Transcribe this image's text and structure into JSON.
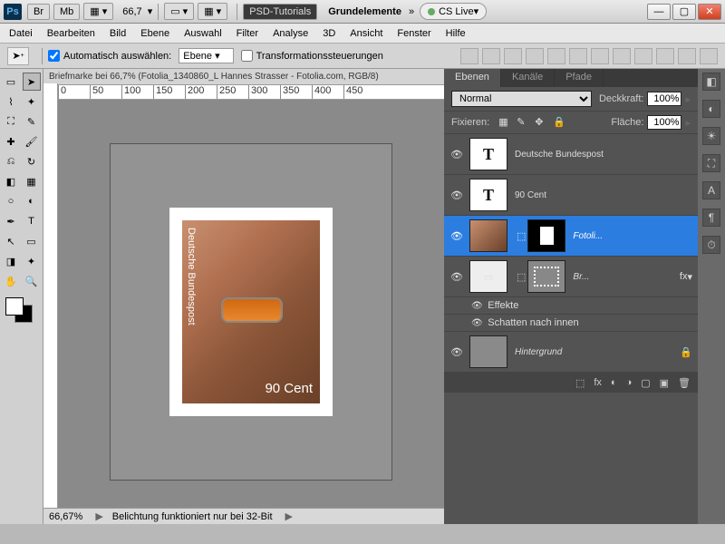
{
  "titlebar": {
    "bridge": "Br",
    "minibridge": "Mb",
    "zoom": "66,7",
    "tutorials": "PSD-Tutorials",
    "grundelemente": "Grundelemente",
    "chevrons": "»",
    "cslive": "CS Live"
  },
  "menu": [
    "Datei",
    "Bearbeiten",
    "Bild",
    "Ebene",
    "Auswahl",
    "Filter",
    "Analyse",
    "3D",
    "Ansicht",
    "Fenster",
    "Hilfe"
  ],
  "options": {
    "auto_select": "Automatisch auswählen:",
    "auto_select_val": "Ebene",
    "transform": "Transformationssteuerungen"
  },
  "doc_tab": "Briefmarke bei 66,7% (Fotolia_1340860_L Hannes Strasser - Fotolia.com, RGB/8)",
  "ruler_marks": [
    "0",
    "50",
    "100",
    "150",
    "200",
    "250",
    "300",
    "350",
    "400",
    "450"
  ],
  "stamp": {
    "top_text": "Deutsche Bundespost",
    "value": "90 Cent"
  },
  "status": {
    "zoom": "66,67%",
    "msg": "Belichtung funktioniert nur bei 32-Bit"
  },
  "panel": {
    "tabs": [
      "Ebenen",
      "Kanäle",
      "Pfade"
    ],
    "blend": "Normal",
    "opacity_label": "Deckkraft:",
    "opacity": "100%",
    "lock_label": "Fixieren:",
    "fill_label": "Fläche:",
    "fill": "100%",
    "layers": [
      {
        "name": "Deutsche Bundespost",
        "type": "text"
      },
      {
        "name": "90 Cent",
        "type": "text"
      },
      {
        "name": "Fotoli...",
        "type": "image",
        "selected": true
      },
      {
        "name": "Br...",
        "type": "stamp",
        "fx": true
      },
      {
        "name": "Hintergrund",
        "type": "bg",
        "locked": true
      }
    ],
    "effects_label": "Effekte",
    "effect_item": "Schatten nach innen",
    "fx_label": "fx"
  }
}
